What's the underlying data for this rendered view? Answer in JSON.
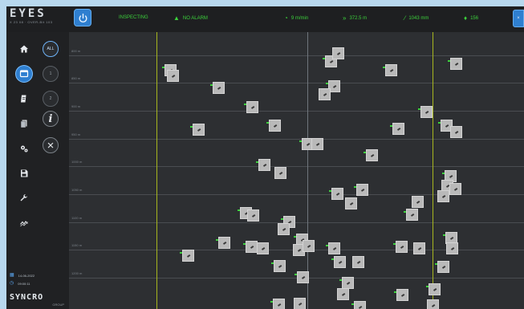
{
  "app": {
    "logo_word": "EYES",
    "logo_sub": "X 23 08 · OVER-Bit 103",
    "brand_word": "SYNCRO",
    "brand_sub": "GROUP"
  },
  "topbar": {
    "status_inspecting": "INSPECTING",
    "status_alarm": "NO ALARM",
    "speed": "9 m/min",
    "distance": "372.5 m",
    "width": "1043 mm",
    "count": "156",
    "accent_color": "#3bd13b",
    "corner_label": "×"
  },
  "sidebar": {
    "nav": [
      {
        "name": "home",
        "icon": "home-icon"
      },
      {
        "name": "monitor",
        "icon": "monitor-icon",
        "active": true
      },
      {
        "name": "report",
        "icon": "report-icon"
      },
      {
        "name": "documents",
        "icon": "documents-icon"
      },
      {
        "name": "settings",
        "icon": "gears-icon"
      },
      {
        "name": "save",
        "icon": "save-icon"
      },
      {
        "name": "tools",
        "icon": "wrench-icon"
      },
      {
        "name": "trend",
        "icon": "trend-icon"
      }
    ],
    "filters": [
      {
        "label": "ALL",
        "selected": true
      },
      {
        "label": "1"
      },
      {
        "label": "2"
      }
    ],
    "info_label": "i",
    "close_label": "×",
    "date": "14-06-2022",
    "time": "09:00:11"
  },
  "plot": {
    "row_labels": [
      "800 m",
      "850 m",
      "900 m",
      "950 m",
      "1000 m",
      "1050 m",
      "1100 m",
      "1150 m",
      "1200 m"
    ],
    "guide_color": "#a7b61f"
  }
}
